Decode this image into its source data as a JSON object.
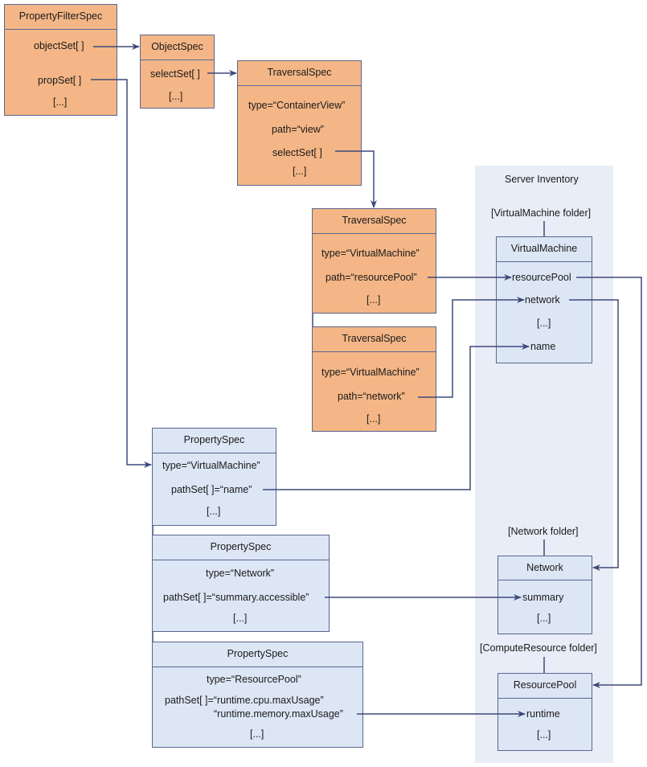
{
  "inventory": {
    "title": "Server Inventory",
    "vm_folder": "[VirtualMachine folder]",
    "net_folder": "[Network folder]",
    "cr_folder": "[ComputeResource folder]",
    "vm": {
      "title": "VirtualMachine",
      "props": [
        "resourcePool",
        "network",
        "[...]",
        "name"
      ]
    },
    "network": {
      "title": "Network",
      "props": [
        "summary",
        "[...]"
      ]
    },
    "resourcepool": {
      "title": "ResourcePool",
      "props": [
        "runtime",
        "[...]"
      ]
    }
  },
  "pfs": {
    "title": "PropertyFilterSpec",
    "props": [
      "objectSet[ ]",
      "propSet[ ]",
      "[...]"
    ]
  },
  "os": {
    "title": "ObjectSpec",
    "props": [
      "selectSet[ ]",
      "[...]"
    ]
  },
  "ts1": {
    "title": "TraversalSpec",
    "props": [
      "type=“ContainerView”",
      "path=“view”",
      "selectSet[ ]",
      "[...]"
    ]
  },
  "ts2": {
    "title": "TraversalSpec",
    "props": [
      "type=“VirtualMachine”",
      "path=“resourcePool”",
      "[...]"
    ]
  },
  "ts3": {
    "title": "TraversalSpec",
    "props": [
      "type=“VirtualMachine”",
      "path=“network”",
      "[...]"
    ]
  },
  "ps1": {
    "title": "PropertySpec",
    "props": [
      "type=“VirtualMachine”",
      "pathSet[ ]=“name”",
      "[...]"
    ]
  },
  "ps2": {
    "title": "PropertySpec",
    "props": [
      "type=“Network”",
      "pathSet[ ]=“summary.accessible”",
      "[...]"
    ]
  },
  "ps3": {
    "title": "PropertySpec",
    "props": [
      "type=“ResourcePool”",
      "pathSet[ ]=“runtime.cpu.maxUsage”",
      "“runtime.memory.maxUsage”",
      "[...]"
    ]
  },
  "colors": {
    "spec_fill": "#f4b686",
    "object_fill": "#dde6f5",
    "inventory_bg": "#e8edf7",
    "line": "#3d4a7a"
  }
}
